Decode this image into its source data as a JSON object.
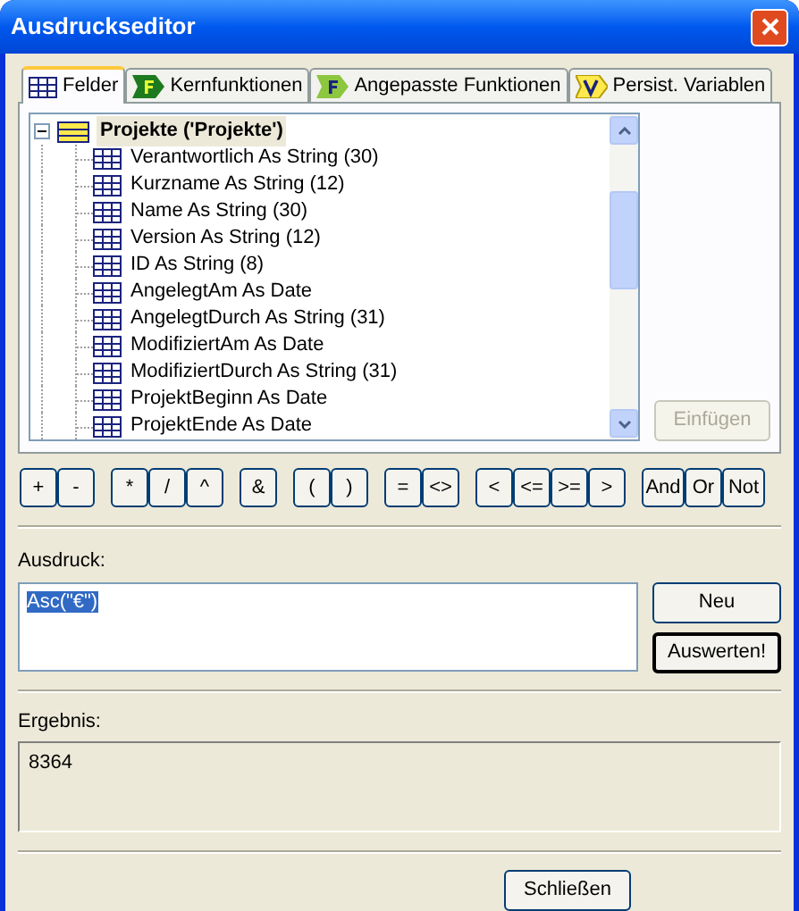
{
  "window": {
    "title": "Ausdruckseditor"
  },
  "tabs": [
    {
      "label": "Felder",
      "selected": true
    },
    {
      "label": "Kernfunktionen",
      "selected": false
    },
    {
      "label": "Angepasste Funktionen",
      "selected": false
    },
    {
      "label": "Persist. Variablen",
      "selected": false
    }
  ],
  "tree": {
    "label": "Projekte ('Projekte')",
    "expanded": true,
    "selected": true,
    "children": [
      {
        "label": "Verantwortlich As String (30)",
        "selected": false
      },
      {
        "label": "Kurzname As String (12)",
        "selected": false
      },
      {
        "label": "Name As String (30)",
        "selected": false
      },
      {
        "label": "Version As String (12)",
        "selected": false
      },
      {
        "label": "ID As String (8)",
        "selected": false
      },
      {
        "label": "AngelegtAm As Date",
        "selected": false
      },
      {
        "label": "AngelegtDurch As String (31)",
        "selected": false
      },
      {
        "label": "ModifiziertAm As Date",
        "selected": false
      },
      {
        "label": "ModifiziertDurch As String (31)",
        "selected": false
      },
      {
        "label": "ProjektBeginn As Date",
        "selected": false
      },
      {
        "label": "ProjektEnde As Date",
        "selected": false
      }
    ]
  },
  "insert_button": {
    "label": "Einfügen",
    "disabled": true
  },
  "operator_groups": [
    [
      "+",
      "-"
    ],
    [
      "*",
      "/",
      "^"
    ],
    [
      "&"
    ],
    [
      "(",
      ")"
    ],
    [
      "=",
      "<>"
    ],
    [
      "<",
      "<=",
      ">=",
      ">"
    ],
    [
      "And",
      "Or",
      "Not"
    ]
  ],
  "expression": {
    "label": "Ausdruck:",
    "value": "Asc(\"€\")",
    "selected": true
  },
  "expression_buttons": [
    {
      "label": "Neu",
      "default": false
    },
    {
      "label": "Auswerten!",
      "default": true
    }
  ],
  "result": {
    "label": "Ergebnis:",
    "value": "8364"
  },
  "close_button": {
    "label": "Schließen"
  }
}
